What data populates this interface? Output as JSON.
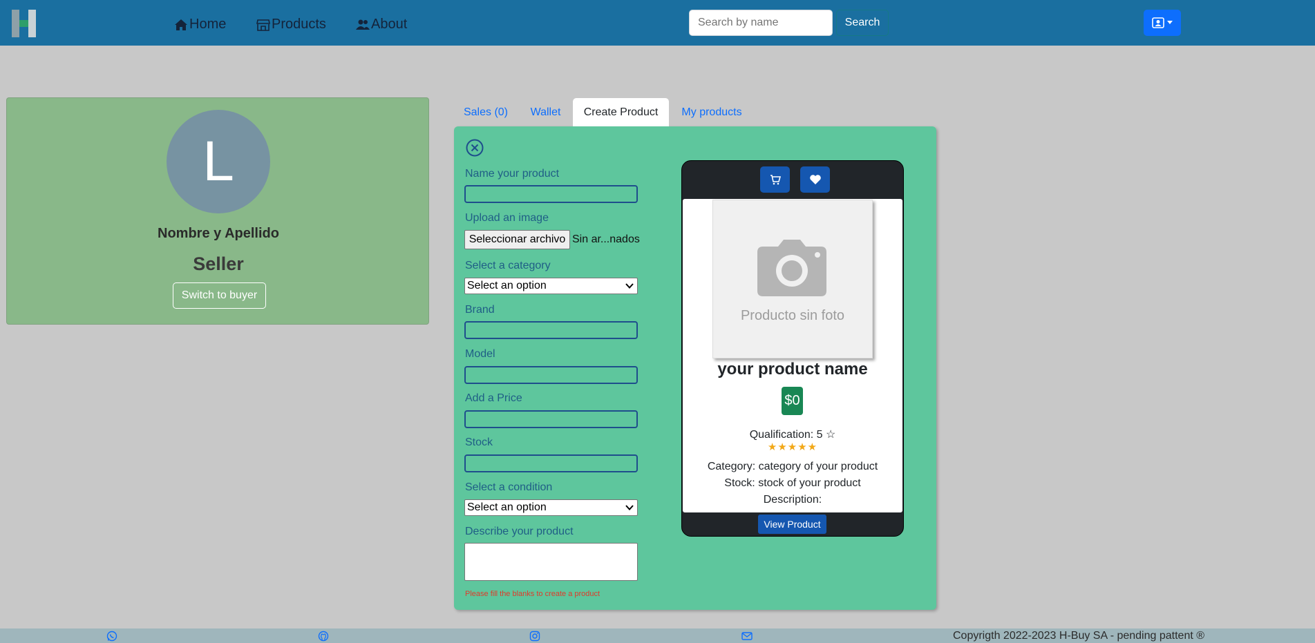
{
  "navbar": {
    "links": [
      {
        "label": "Home",
        "icon": "home-icon"
      },
      {
        "label": "Products",
        "icon": "store-icon"
      },
      {
        "label": "About",
        "icon": "users-icon"
      }
    ],
    "search": {
      "placeholder": "Search by name",
      "button_label": "Search"
    },
    "user_menu_icon": "user-card-icon",
    "bg_color": "#1a6fa0"
  },
  "profile": {
    "avatar_initial": "L",
    "name": "Nombre y Apellido",
    "role": "Seller",
    "switch_label": "Switch to buyer"
  },
  "tabs": [
    {
      "label": "Sales (0)",
      "active": false
    },
    {
      "label": "Wallet",
      "active": false
    },
    {
      "label": "Create Product",
      "active": true
    },
    {
      "label": "My products",
      "active": false
    }
  ],
  "form": {
    "name_label": "Name your product",
    "name_value": "",
    "image_label": "Upload an image",
    "file_button": "Seleccionar archivo",
    "file_status": "Sin ar...nados",
    "category_label": "Select a category",
    "category_selected": "Select an option",
    "brand_label": "Brand",
    "brand_value": "",
    "model_label": "Model",
    "model_value": "",
    "price_label": "Add a Price",
    "price_value": "",
    "stock_label": "Stock",
    "stock_value": "",
    "condition_label": "Select a condition",
    "condition_selected": "Select an option",
    "description_label": "Describe your product",
    "description_value": "",
    "error_message": "Please fill the blanks to create a product"
  },
  "preview": {
    "photo_placeholder": "Producto sin foto",
    "product_name": "your product name",
    "price": "$0",
    "qualification": "Qualification: 5 ☆",
    "stars": "★★★★★",
    "rating": 5,
    "category": "Category: category of your product",
    "stock": "Stock: stock of your product",
    "description": "Description:",
    "view_button": "View Product"
  },
  "footer": {
    "icons": [
      "whatsapp-icon",
      "github-icon",
      "instagram-icon",
      "mail-icon"
    ],
    "copyright": "Copyrigth 2022-2023 H-Buy SA - pending pattent ®"
  },
  "colors": {
    "panel_bg": "#5ec69d",
    "profile_bg": "#89b889",
    "accent": "#0d6efd",
    "price_badge": "#198754",
    "error": "#e03a2a"
  }
}
